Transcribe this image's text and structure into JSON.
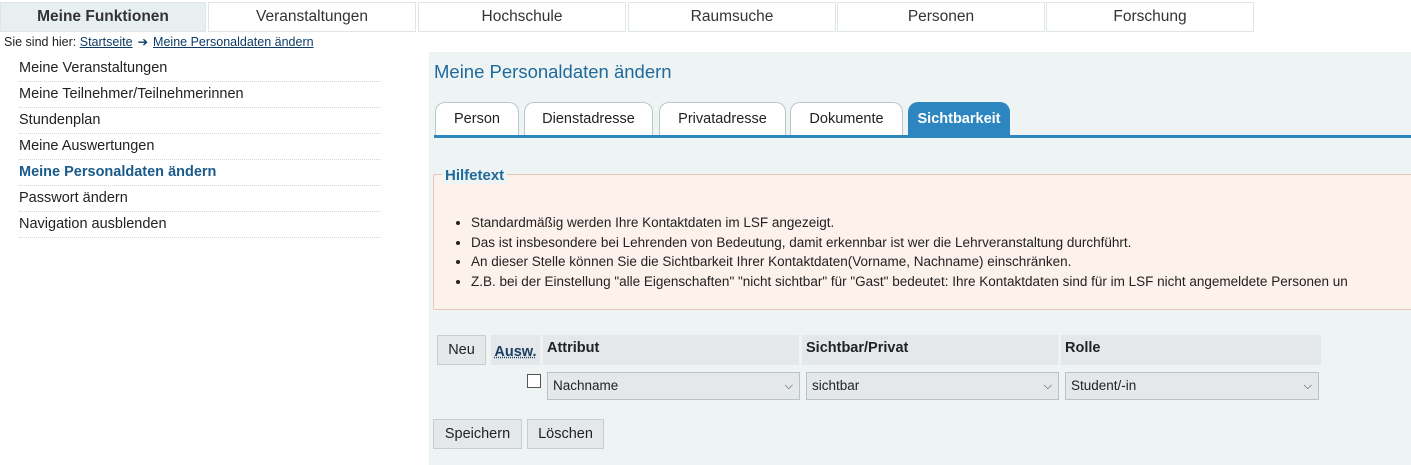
{
  "topnav": {
    "tabs": [
      "Meine Funktionen",
      "Veranstaltungen",
      "Hochschule",
      "Raumsuche",
      "Personen",
      "Forschung"
    ]
  },
  "breadcrumb": {
    "prefix": "Sie sind hier:",
    "start": "Startseite",
    "current": "Meine Personaldaten ändern"
  },
  "leftnav": {
    "items": [
      "Meine Veranstaltungen",
      "Meine Teilnehmer/Teilnehmerinnen",
      "Stundenplan",
      "Meine Auswertungen",
      "Meine Personaldaten ändern",
      "Passwort ändern",
      "Navigation ausblenden"
    ]
  },
  "main": {
    "title": "Meine Personaldaten ändern",
    "subtabs": [
      "Person",
      "Dienstadresse",
      "Privatadresse",
      "Dokumente",
      "Sichtbarkeit"
    ]
  },
  "help": {
    "legend": "Hilfetext",
    "bullets": [
      "Standardmäßig werden Ihre Kontaktdaten im LSF angezeigt.",
      "Das ist insbesondere bei Lehrenden von Bedeutung, damit erkennbar ist wer die Lehrveranstaltung durchführt.",
      "An dieser Stelle können Sie die Sichtbarkeit Ihrer Kontaktdaten(Vorname, Nachname) einschränken.",
      "Z.B. bei der Einstellung \"alle Eigenschaften\" \"nicht sichtbar\" für \"Gast\" bedeutet: Ihre Kontaktdaten sind für im LSF nicht angemeldete Personen un"
    ]
  },
  "table": {
    "new_button": "Neu",
    "headers": {
      "ausw": "Ausw.",
      "attribut": "Attribut",
      "sichtbar": "Sichtbar/Privat",
      "rolle": "Rolle"
    },
    "row": {
      "attribut": "Nachname",
      "sichtbar": "sichtbar",
      "rolle": "Student/-in"
    }
  },
  "actions": {
    "save": "Speichern",
    "delete": "Löschen"
  }
}
